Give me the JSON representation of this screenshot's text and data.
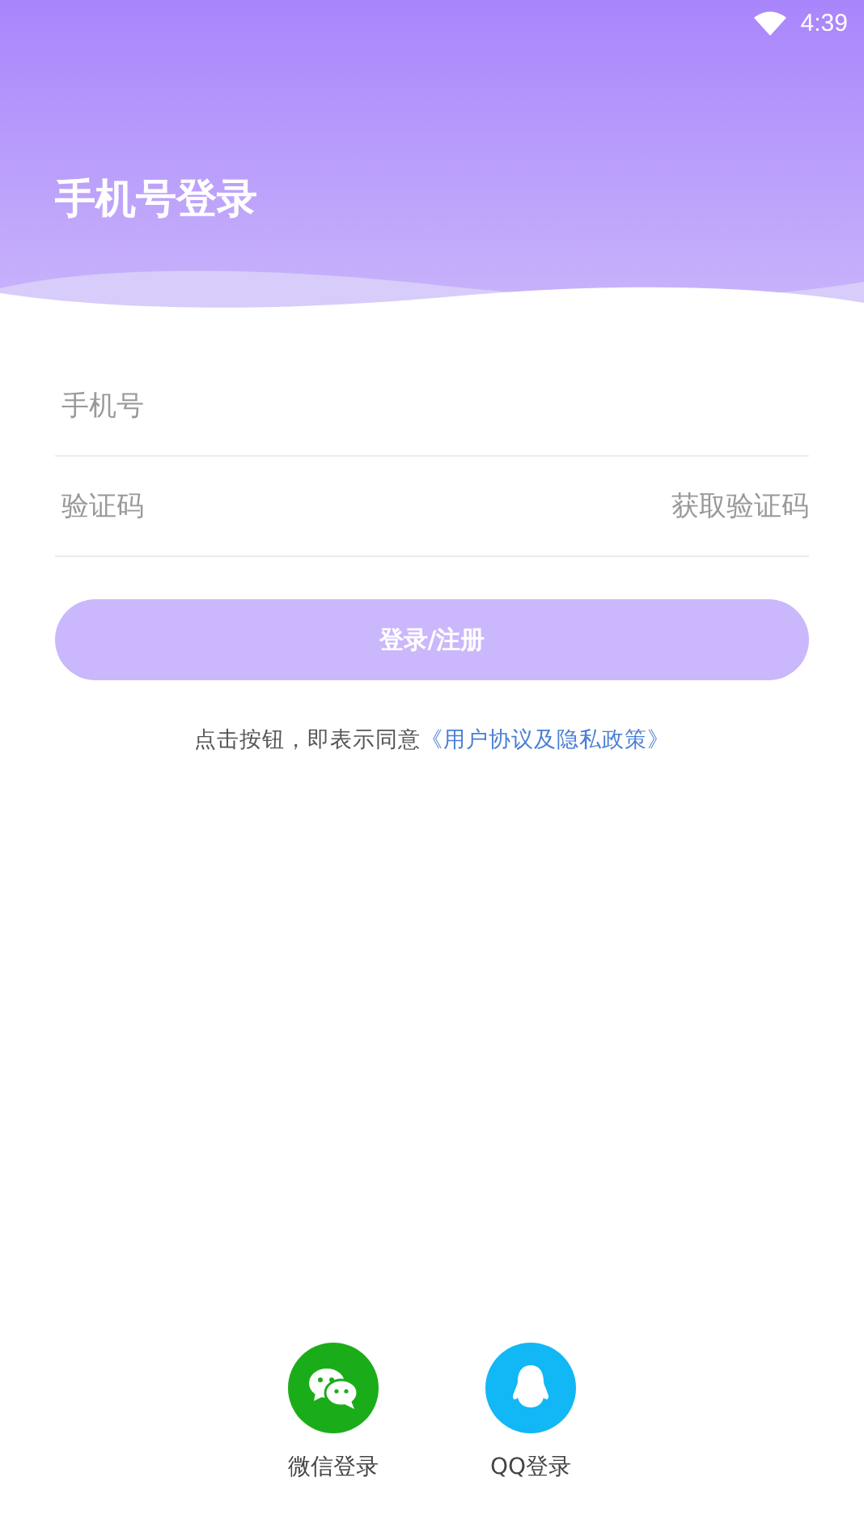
{
  "status_bar": {
    "time": "4:39"
  },
  "title": "手机号登录",
  "fields": [
    {
      "placeholder": "手机号"
    },
    {
      "placeholder": "验证码",
      "action": "获取验证码"
    }
  ],
  "submit": {
    "label": "登录/注册",
    "disabled": true
  },
  "agreement": {
    "text": "点击按钮，即表示同意",
    "link": "《用户协议及隐私政策》"
  },
  "social": [
    {
      "kind": "wechat",
      "label": "微信登录",
      "color": "#1aad19"
    },
    {
      "kind": "qq",
      "label": "QQ登录",
      "color": "#12b7f5"
    }
  ]
}
